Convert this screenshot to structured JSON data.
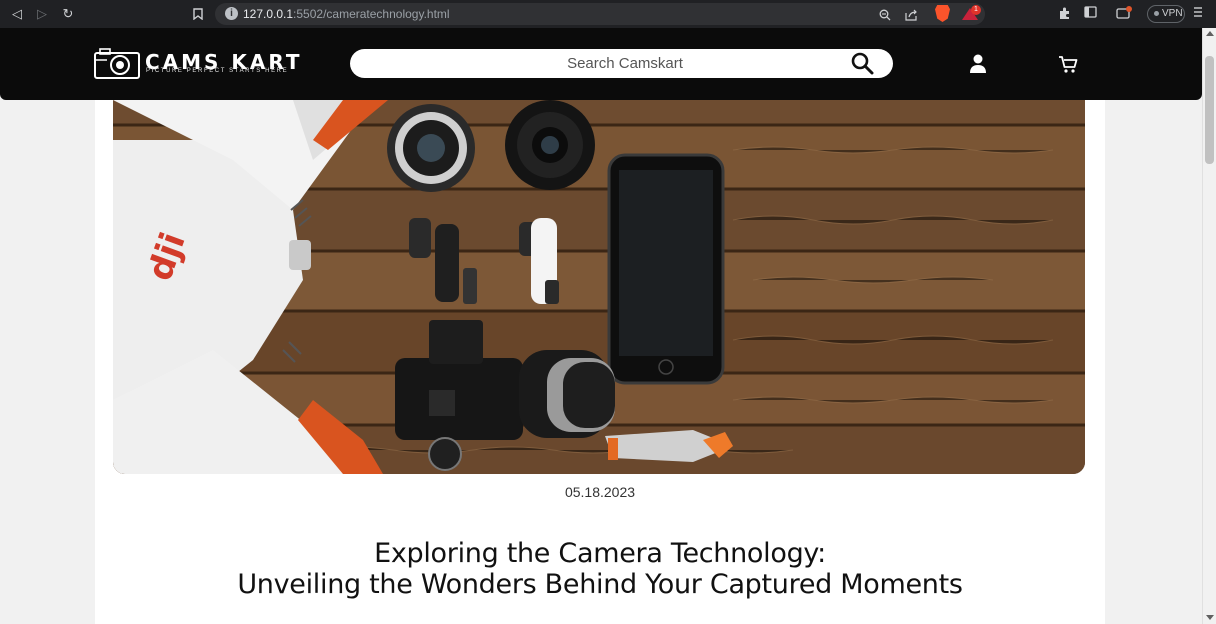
{
  "browser": {
    "url_host": "127.0.0.1",
    "url_rest": ":5502/cameratechnology.html",
    "notification_count": "1",
    "vpn_label": "VPN",
    "icons": [
      "back-icon",
      "forward-icon",
      "reload-icon",
      "bookmark-icon",
      "site-info-icon",
      "zoom-icon",
      "share-icon",
      "brave-shields-icon",
      "brave-rewards-icon",
      "extensions-icon",
      "sidebar-icon",
      "wallet-icon",
      "menu-icon"
    ]
  },
  "header": {
    "logo_title": "CAMS KART",
    "logo_tagline": "PICTURE PERFECT STARTS HERE",
    "search_placeholder": "Search Camskart",
    "icons": [
      "search-icon",
      "user-icon",
      "cart-icon"
    ]
  },
  "article": {
    "date": "05.18.2023",
    "title_line1": "Exploring the Camera Technology:",
    "title_line2": "Unveiling the Wonders Behind Your Captured Moments",
    "hero_brand_text": "dji"
  },
  "colors": {
    "header_bg": "#0b0b0b",
    "page_bg": "#f1f1f1",
    "card_bg": "#ffffff",
    "wood": "#6b4a30",
    "accent_orange": "#e0551f"
  }
}
